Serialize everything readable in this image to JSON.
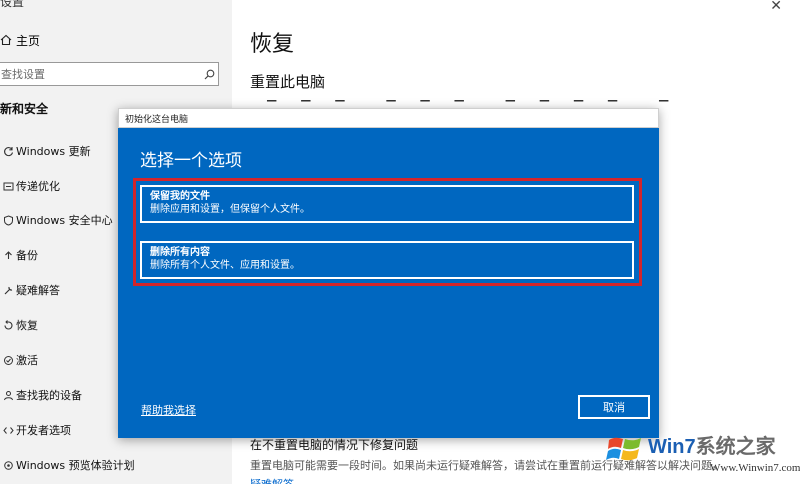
{
  "sidebar": {
    "top_partial": "设置",
    "home_label": "主页",
    "search_placeholder": "查找设置",
    "section": "更新和安全",
    "items": [
      {
        "label": "Windows 更新",
        "icon": "sync-icon"
      },
      {
        "label": "传递优化",
        "icon": "delivery-icon"
      },
      {
        "label": "Windows 安全中心",
        "icon": "shield-icon"
      },
      {
        "label": "备份",
        "icon": "backup-icon"
      },
      {
        "label": "疑难解答",
        "icon": "wrench-icon"
      },
      {
        "label": "恢复",
        "icon": "recovery-icon"
      },
      {
        "label": "激活",
        "icon": "check-circle-icon"
      },
      {
        "label": "查找我的设备",
        "icon": "person-locate-icon"
      },
      {
        "label": "开发者选项",
        "icon": "developer-icon"
      },
      {
        "label": "Windows 预览体验计划",
        "icon": "insider-icon"
      }
    ]
  },
  "main": {
    "title": "恢复",
    "section_title": "重置此电脑",
    "fix_title": "在不重置电脑的情况下修复问题",
    "fix_desc": "重置电脑可能需要一段时间。如果尚未运行疑难解答，请尝试在重置前运行疑难解答以解决问题。",
    "fix_link": "疑难解答"
  },
  "dialog": {
    "window_title": "初始化这台电脑",
    "heading": "选择一个选项",
    "options": [
      {
        "title": "保留我的文件",
        "desc": "删除应用和设置，但保留个人文件。"
      },
      {
        "title": "删除所有内容",
        "desc": "删除所有个人文件、应用和设置。"
      }
    ],
    "help_link": "帮助我选择",
    "cancel_label": "取消"
  },
  "watermark": {
    "brand": "Win7",
    "brand_cn": "系统之家",
    "url": "Www.Winwin7.com"
  },
  "colors": {
    "dialog_bg": "#0067c0",
    "highlight": "#d4252b",
    "sidebar_bg": "#f2f2f2"
  }
}
